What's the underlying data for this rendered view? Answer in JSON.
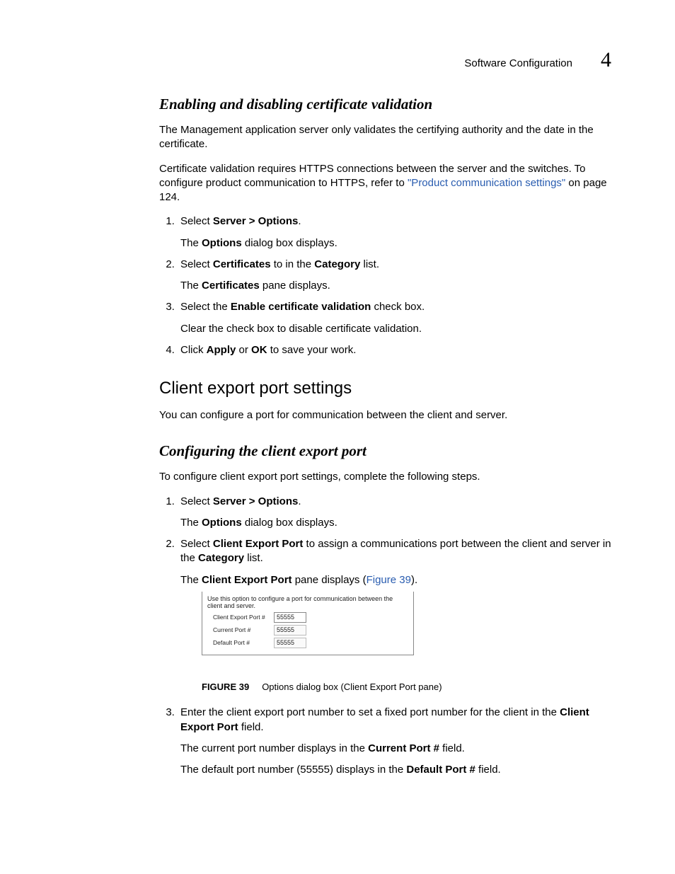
{
  "header": {
    "title": "Software Configuration",
    "chapter": "4"
  },
  "sections": {
    "sec1": {
      "heading": "Enabling and disabling certificate validation",
      "p1": "The Management application server only validates the certifying authority and the date in the certificate.",
      "p2a": "Certificate validation requires HTTPS connections between the server and the switches. To configure product communication to HTTPS, refer to ",
      "p2link": "\"Product communication settings\"",
      "p2b": " on page 124.",
      "li1a": "Select ",
      "li1b": "Server > Options",
      "li1c": ".",
      "li1sub_a": "The ",
      "li1sub_b": "Options",
      "li1sub_c": " dialog box displays.",
      "li2a": "Select ",
      "li2b": "Certificates",
      "li2c": " to in the ",
      "li2d": "Category",
      "li2e": " list.",
      "li2sub_a": "The ",
      "li2sub_b": "Certificates",
      "li2sub_c": " pane displays.",
      "li3a": "Select the ",
      "li3b": "Enable certificate validation",
      "li3c": " check box.",
      "li3sub": "Clear the check box to disable certificate validation.",
      "li4a": "Click ",
      "li4b": "Apply",
      "li4c": " or ",
      "li4d": "OK",
      "li4e": " to save your work."
    },
    "sec2": {
      "heading": "Client export port settings",
      "p1": "You can configure a port for communication between the client and server."
    },
    "sec3": {
      "heading": "Configuring the client export port",
      "p1": "To configure client export port settings, complete the following steps.",
      "li1a": "Select ",
      "li1b": "Server > Options",
      "li1c": ".",
      "li1sub_a": "The ",
      "li1sub_b": "Options",
      "li1sub_c": " dialog box displays.",
      "li2a": "Select ",
      "li2b": "Client Export Port",
      "li2c": " to assign a communications port between the client and server in the ",
      "li2d": "Category",
      "li2e": " list.",
      "li2sub_a": "The ",
      "li2sub_b": "Client Export Port",
      "li2sub_c": " pane displays (",
      "li2sub_link": "Figure 39",
      "li2sub_d": ").",
      "figure": {
        "desc": "Use this option to configure a port for communication between the client and server.",
        "row1_label": "Client Export Port #",
        "row1_value": "55555",
        "row2_label": "Current Port #",
        "row2_value": "55555",
        "row3_label": "Default Port #",
        "row3_value": "55555"
      },
      "caption_num": "FIGURE 39",
      "caption_text": "Options dialog box (Client Export Port pane)",
      "li3a": "Enter the client export port number to set a fixed port number for the client in the ",
      "li3b": "Client Export Port",
      "li3c": " field.",
      "li3sub1_a": "The current port number displays in the ",
      "li3sub1_b": "Current Port #",
      "li3sub1_c": " field.",
      "li3sub2_a": "The default port number (55555) displays in the ",
      "li3sub2_b": "Default Port #",
      "li3sub2_c": " field."
    }
  }
}
